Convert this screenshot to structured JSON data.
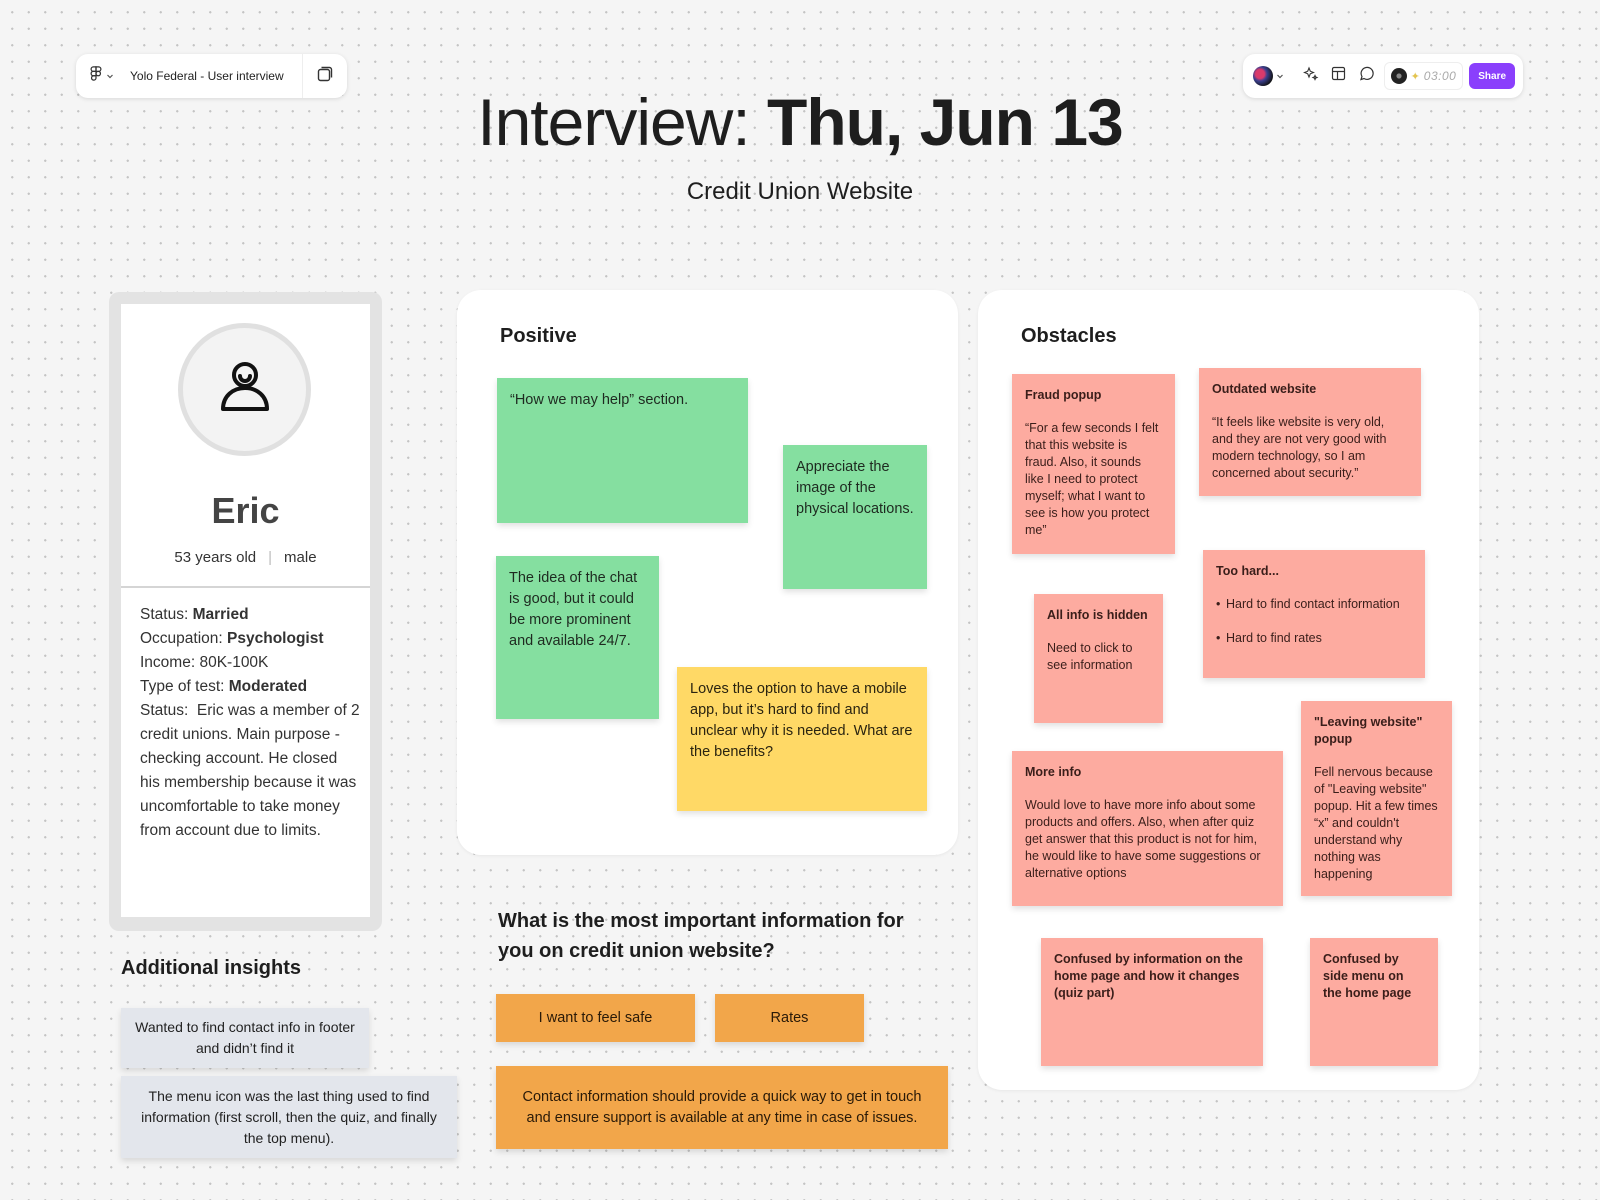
{
  "toolbar_left": {
    "file_title": "Yolo Federal - User interview",
    "menu_icon": "figma-logo-icon",
    "pages_icon": "pages-icon"
  },
  "toolbar_right": {
    "timer": "03:00",
    "share_label": "Share",
    "share_color": "#8a3ffc",
    "icons": [
      "user-avatar",
      "ai-sparkle-icon",
      "layout-icon",
      "comment-icon",
      "music-timer-icon"
    ]
  },
  "header": {
    "title_prefix": "Interview:",
    "title_date": "Thu, Jun 13",
    "subtitle": "Credit Union Website"
  },
  "profile": {
    "name": "Eric",
    "age": "53 years old",
    "gender": "male",
    "details": [
      {
        "label": "Status: ",
        "value": "Married",
        "bold": true
      },
      {
        "label": "Occupation: ",
        "value": "Psychologist",
        "bold": true
      },
      {
        "label": "Income: ",
        "value": "80K-100K",
        "bold": false
      },
      {
        "label": "Type of test: ",
        "value": "Moderated",
        "bold": true
      },
      {
        "label": "Status:  ",
        "value": "Eric was a member of 2 credit unions. Main purpose - checking account. He closed his membership because it was uncomfortable to take money from account due to limits.",
        "bold": false
      }
    ]
  },
  "insights": {
    "title": "Additional insights",
    "items": [
      "Wanted to find contact info in footer and didn’t find it",
      "The menu icon was the last thing used to find information (first scroll, then the quiz, and finally the top menu)."
    ]
  },
  "positive": {
    "title": "Positive",
    "notes": [
      {
        "text": "“How we may help” section.",
        "color": "green"
      },
      {
        "text": "Appreciate the image of the physical locations.",
        "color": "green"
      },
      {
        "text": "The idea of the chat is good, but it could be more prominent and available 24/7.",
        "color": "green"
      },
      {
        "text": "Loves the option to have a mobile app, but it’s hard to find and unclear why it is needed. What are the benefits?",
        "color": "yellow"
      }
    ]
  },
  "obstacles": {
    "title": "Obstacles",
    "notes": [
      {
        "title": "Fraud popup",
        "body": "“For a few seconds I felt that this website is fraud. Also, it sounds like I need to protect myself; what I want to see is how you protect me”"
      },
      {
        "title": "Outdated website",
        "body": "“It feels like website is very old, and they are not very good with modern technology, so I am concerned about security.”"
      },
      {
        "title": "Too hard...",
        "bullets": [
          "Hard to find contact information",
          "Hard to find rates"
        ]
      },
      {
        "title": "All info is hidden",
        "body": "Need to click to see information"
      },
      {
        "title": "\"Leaving website\" popup",
        "body": "Fell nervous because of \"Leaving website\" popup. Hit a few times “x” and couldn't understand why nothing was happening"
      },
      {
        "title": "More info",
        "body": "Would love to have more info about some products and offers. Also, when after quiz get answer that this product is not for him, he would like to have some suggestions or alternative options"
      },
      {
        "title": "Confused by information on the home page and how it changes (quiz part)"
      },
      {
        "title": "Confused by side menu on the home page"
      }
    ]
  },
  "question": {
    "text": "What is the most important information for you on credit union website?",
    "answers": [
      "I want to feel safe",
      "Rates",
      "Contact information should provide a quick way to get in touch and ensure support is available at any time in case of issues."
    ]
  },
  "colors": {
    "green_note": "#85dfa0",
    "yellow_note": "#ffd966",
    "orange_note": "#f2a64a",
    "salmon_note": "#fdaba0",
    "insight_note": "#e3e6ec",
    "canvas": "#f5f5f5"
  }
}
